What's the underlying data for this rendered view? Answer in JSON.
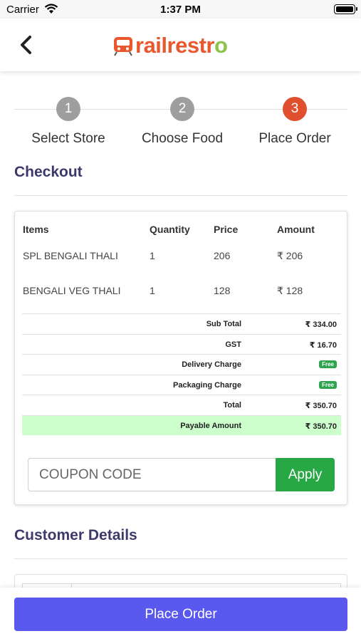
{
  "status_bar": {
    "carrier": "Carrier",
    "time": "1:37 PM"
  },
  "header": {
    "logo_text_start": "railrestr",
    "logo_text_end": "o",
    "logo_accent": "#e8572d",
    "logo_secondary": "#8bc34a"
  },
  "steps": [
    {
      "number": "1",
      "label": "Select Store",
      "active": false
    },
    {
      "number": "2",
      "label": "Choose Food",
      "active": false
    },
    {
      "number": "3",
      "label": "Place Order",
      "active": true
    }
  ],
  "checkout": {
    "title": "Checkout",
    "headers": {
      "items": "Items",
      "quantity": "Quantity",
      "price": "Price",
      "amount": "Amount"
    },
    "items": [
      {
        "name": "SPL BENGALI THALI",
        "qty": "1",
        "price": "206",
        "amount": "₹  206"
      },
      {
        "name": "BENGALI VEG THALI",
        "qty": "1",
        "price": "128",
        "amount": "₹  128"
      }
    ],
    "summary": [
      {
        "label": "Sub Total",
        "value": "₹ 334.00"
      },
      {
        "label": "GST",
        "value": "₹ 16.70"
      },
      {
        "label": "Delivery Charge",
        "value": "Free",
        "badge": true
      },
      {
        "label": "Packaging Charge",
        "value": "Free",
        "badge": true
      },
      {
        "label": "Total",
        "value": "₹ 350.70"
      },
      {
        "label": "Payable Amount",
        "value": "₹ 350.70",
        "highlight": true
      }
    ],
    "coupon_placeholder": "COUPON CODE",
    "apply_label": "Apply"
  },
  "customer": {
    "title": "Customer Details"
  },
  "footer": {
    "place_order_label": "Place Order"
  },
  "colors": {
    "primary": "#5a59ef",
    "apply": "#27a844",
    "active_step": "#e0502f",
    "payable_bg": "#ccffcc",
    "title": "#3d3a6b"
  }
}
